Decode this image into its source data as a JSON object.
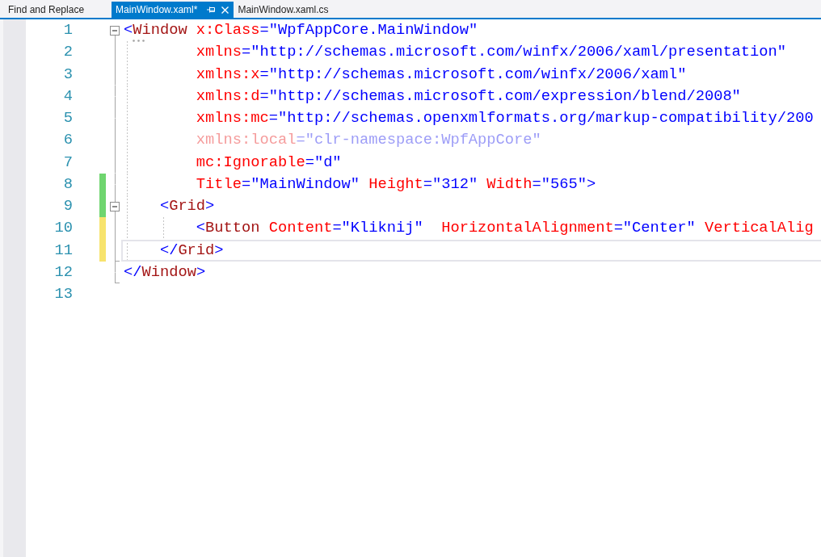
{
  "tabs": [
    {
      "label": "Find and Replace",
      "selected": false
    },
    {
      "label": "MainWindow.xaml*",
      "selected": true
    },
    {
      "label": "MainWindow.xaml.cs",
      "selected": false
    }
  ],
  "editor": {
    "lines": [
      {
        "number": "1",
        "expanded": true,
        "current": false,
        "dimmed": false,
        "hint": true,
        "tokens": [
          {
            "kind": "bracket",
            "text": "<"
          },
          {
            "kind": "tag",
            "text": "Window"
          },
          {
            "kind": "attr",
            "text": " x:Class"
          },
          {
            "kind": "punct",
            "text": "="
          },
          {
            "kind": "value",
            "text": "\"WpfAppCore.MainWindow\""
          }
        ],
        "children": [
          {
            "number": "2",
            "kind": "continuation",
            "current": false,
            "dimmed": false,
            "hint": false,
            "tokens": [
              {
                "kind": "attr",
                "text": "xmlns"
              },
              {
                "kind": "punct",
                "text": "="
              },
              {
                "kind": "value",
                "text": "\"http://schemas.microsoft.com/winfx/2006/xaml/presentation\""
              }
            ]
          },
          {
            "number": "3",
            "kind": "continuation",
            "current": false,
            "dimmed": false,
            "hint": false,
            "tokens": [
              {
                "kind": "attr",
                "text": "xmlns:x"
              },
              {
                "kind": "punct",
                "text": "="
              },
              {
                "kind": "value",
                "text": "\"http://schemas.microsoft.com/winfx/2006/xaml\""
              }
            ]
          },
          {
            "number": "4",
            "kind": "continuation",
            "current": false,
            "dimmed": false,
            "hint": false,
            "tokens": [
              {
                "kind": "attr",
                "text": "xmlns:d"
              },
              {
                "kind": "punct",
                "text": "="
              },
              {
                "kind": "value",
                "text": "\"http://schemas.microsoft.com/expression/blend/2008\""
              }
            ]
          },
          {
            "number": "5",
            "kind": "continuation",
            "current": false,
            "dimmed": false,
            "hint": false,
            "tokens": [
              {
                "kind": "attr",
                "text": "xmlns:mc"
              },
              {
                "kind": "punct",
                "text": "="
              },
              {
                "kind": "value",
                "text": "\"http://schemas.openxmlformats.org/markup-compatibility/200"
              }
            ]
          },
          {
            "number": "6",
            "kind": "continuation",
            "current": false,
            "dimmed": true,
            "hint": false,
            "tokens": [
              {
                "kind": "attr",
                "text": "xmlns:local"
              },
              {
                "kind": "punct",
                "text": "="
              },
              {
                "kind": "value",
                "text": "\"clr-namespace:WpfAppCore\""
              }
            ]
          },
          {
            "number": "7",
            "kind": "continuation",
            "current": false,
            "dimmed": false,
            "hint": false,
            "tokens": [
              {
                "kind": "attr",
                "text": "mc:Ignorable"
              },
              {
                "kind": "punct",
                "text": "="
              },
              {
                "kind": "value",
                "text": "\"d\""
              }
            ]
          },
          {
            "number": "8",
            "kind": "continuation",
            "color": "#6fd56f",
            "current": false,
            "dimmed": false,
            "hint": false,
            "tokens": [
              {
                "kind": "attr",
                "text": "Title"
              },
              {
                "kind": "punct",
                "text": "="
              },
              {
                "kind": "value",
                "text": "\"MainWindow\""
              },
              {
                "kind": "attr",
                "text": " Height"
              },
              {
                "kind": "punct",
                "text": "="
              },
              {
                "kind": "value",
                "text": "\"312\""
              },
              {
                "kind": "attr",
                "text": " Width"
              },
              {
                "kind": "punct",
                "text": "="
              },
              {
                "kind": "value",
                "text": "\"565\""
              },
              {
                "kind": "bracket",
                "text": ">"
              }
            ]
          },
          {
            "number": "9",
            "kind": "element",
            "color": "#6fd56f",
            "expanded": true,
            "current": false,
            "dimmed": false,
            "hint": false,
            "tokens": [
              {
                "kind": "bracket",
                "text": "<"
              },
              {
                "kind": "tag",
                "text": "Grid"
              },
              {
                "kind": "bracket",
                "text": ">"
              }
            ],
            "children": [
              {
                "number": "10",
                "kind": "element",
                "color": "#f7e36d",
                "current": false,
                "dimmed": false,
                "hint": false,
                "tokens": [
                  {
                    "kind": "bracket",
                    "text": "<"
                  },
                  {
                    "kind": "tag",
                    "text": "Button"
                  },
                  {
                    "kind": "attr",
                    "text": " Content"
                  },
                  {
                    "kind": "punct",
                    "text": "="
                  },
                  {
                    "kind": "value",
                    "text": "\"Kliknij\""
                  },
                  {
                    "kind": "attr",
                    "text": "  HorizontalAlignment"
                  },
                  {
                    "kind": "punct",
                    "text": "="
                  },
                  {
                    "kind": "value",
                    "text": "\"Center\""
                  },
                  {
                    "kind": "attr",
                    "text": " VerticalAlig"
                  }
                ]
              },
              {
                "number": "11",
                "kind": "closing",
                "color": "#f7e36d",
                "current": true,
                "dimmed": false,
                "hint": false,
                "tokens": [
                  {
                    "kind": "bracket",
                    "text": "</"
                  },
                  {
                    "kind": "tag",
                    "text": "Grid"
                  },
                  {
                    "kind": "bracket",
                    "text": ">"
                  }
                ]
              }
            ]
          },
          {
            "number": "12",
            "kind": "closing",
            "current": false,
            "dimmed": false,
            "hint": false,
            "tokens": [
              {
                "kind": "bracket",
                "text": "</"
              },
              {
                "kind": "tag",
                "text": "Window"
              },
              {
                "kind": "bracket",
                "text": ">"
              }
            ]
          }
        ]
      },
      {
        "number": "13",
        "current": false,
        "hint": false
      }
    ]
  }
}
